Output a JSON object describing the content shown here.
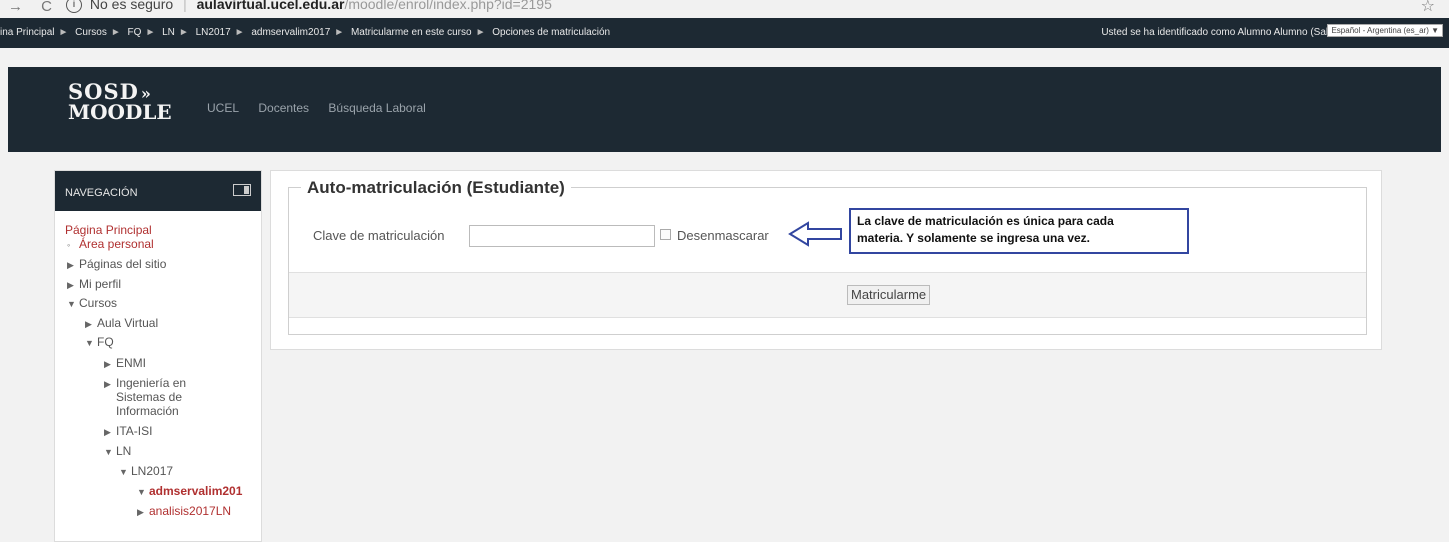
{
  "browser": {
    "nav_back": "→",
    "nav_reload": "C",
    "insecure_label": "No es seguro",
    "host": "aulavirtual.ucel.edu.ar",
    "path": "/moodle/enrol/index.php?id=2195",
    "star": "☆"
  },
  "topbar": {
    "breadcrumbs": [
      "ina Principal",
      "Cursos",
      "FQ",
      "LN",
      "LN2017",
      "admservalim2017",
      "Matricularme en este curso",
      "Opciones de matriculación"
    ],
    "separator": "►",
    "login_text": "Usted se ha identificado como Alumno Alumno (Salir)",
    "language_selected": "Español - Argentina (es_ar) ▼"
  },
  "header": {
    "logo_line1": "SOSD",
    "logo_raquo": "»",
    "logo_line2": "MOODLE",
    "menu": [
      "UCEL",
      "Docentes",
      "Búsqueda Laboral"
    ]
  },
  "navigation": {
    "title": "NAVEGACIÓN",
    "items": [
      {
        "label": "Página Principal",
        "marker": ""
      },
      {
        "label": "Área personal",
        "marker": "◦"
      },
      {
        "label": "Páginas del sitio",
        "marker": "▶"
      },
      {
        "label": "Mi perfil",
        "marker": "▶"
      },
      {
        "label": "Cursos",
        "marker": "▼"
      },
      {
        "label": "Aula Virtual",
        "marker": "▶"
      },
      {
        "label": "FQ",
        "marker": "▼"
      },
      {
        "label": "ENMI",
        "marker": "▶"
      },
      {
        "label": "Ingeniería en",
        "marker": "▶"
      },
      {
        "label": "Sistemas de",
        "marker": ""
      },
      {
        "label": "Información",
        "marker": ""
      },
      {
        "label": "ITA-ISI",
        "marker": "▶"
      },
      {
        "label": "LN",
        "marker": "▼"
      },
      {
        "label": "LN2017",
        "marker": "▼"
      },
      {
        "label": "admservalim201",
        "marker": "▼"
      },
      {
        "label": "analisis2017LN",
        "marker": "▶"
      }
    ]
  },
  "main": {
    "legend": "Auto-matriculación (Estudiante)",
    "key_label": "Clave de matriculación",
    "key_value": "",
    "unmask_label": "Desenmascarar",
    "callout_line1": "La clave de matriculación es única para cada",
    "callout_line2": "materia. Y solamente se ingresa una vez.",
    "submit_label": "Matricularme"
  }
}
